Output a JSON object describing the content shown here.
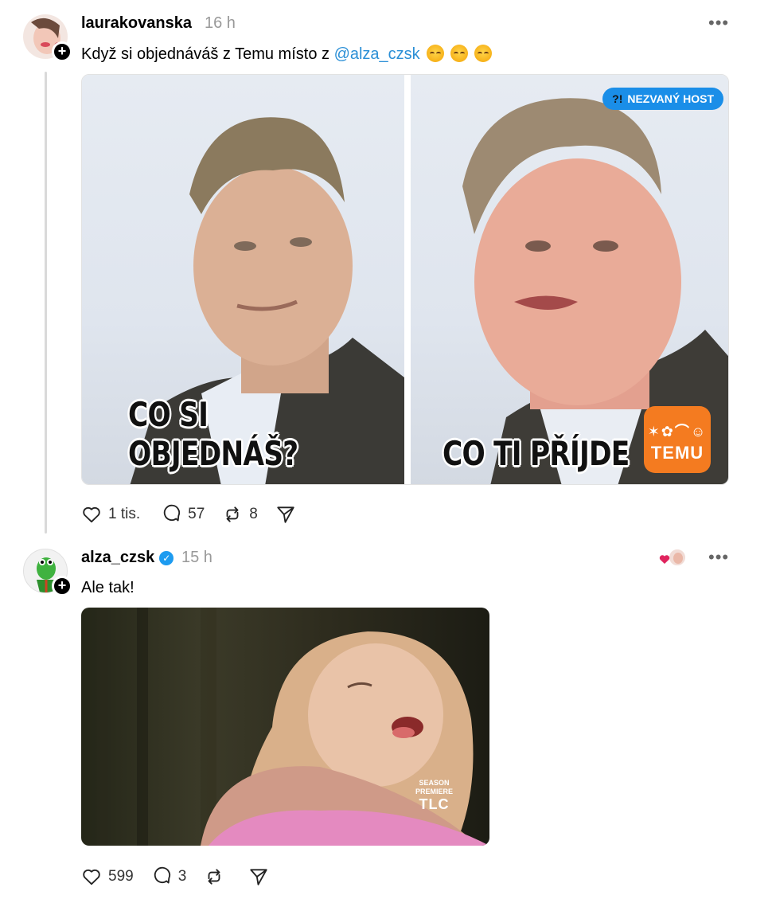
{
  "posts": [
    {
      "username": "laurakovanska",
      "time": "16 h",
      "text_prefix": "Když si objednáváš z Temu místo z ",
      "mention": "@alza_czsk",
      "emojis": [
        "dizzy-face-emoji",
        "dizzy-face-emoji",
        "dizzy-face-emoji"
      ],
      "meme": {
        "left_caption": "CO SI OBJEDNÁŠ?",
        "right_caption": "CO TI PŘÍJDE",
        "badge_icon_text": "?!",
        "badge_text": "NEZVANÝ HOST",
        "brand_logo_text": "TEMU",
        "brand_glyphs": "✶✿⌒☺"
      },
      "actions": {
        "likes": "1 tis.",
        "comments": "57",
        "reposts": "8"
      }
    },
    {
      "username": "alza_czsk",
      "verified": true,
      "time": "15 h",
      "text": "Ale tak!",
      "gif": {
        "watermark_line1": "SEASON",
        "watermark_line2": "PREMIERE",
        "watermark_logo": "TLC"
      },
      "actions": {
        "likes": "599",
        "comments": "3",
        "reposts": ""
      }
    }
  ],
  "colors": {
    "mention": "#2b8fd6",
    "verified": "#1d9bf0",
    "temu": "#f47b20",
    "badge": "#1a8ee8",
    "muted": "#999999"
  }
}
